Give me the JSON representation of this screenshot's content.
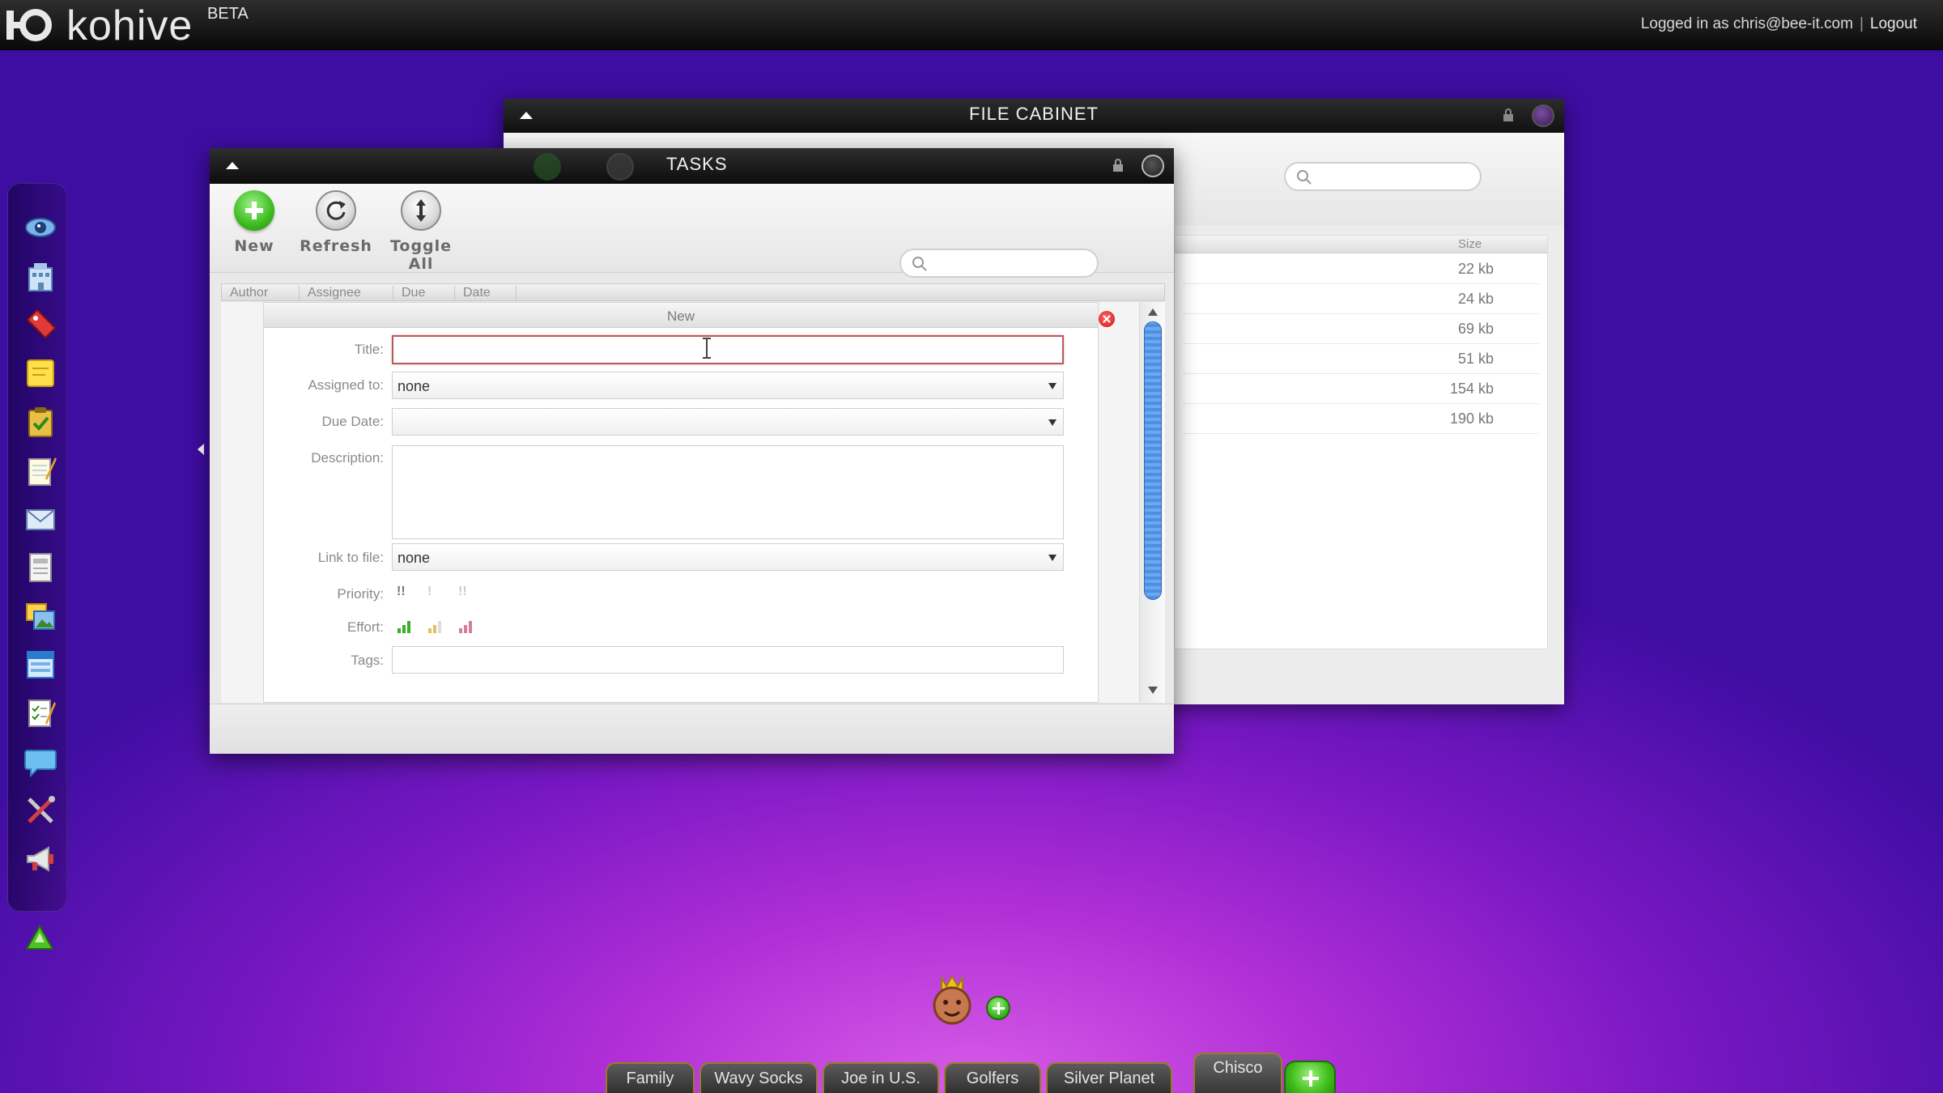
{
  "topbar": {
    "app_name": "kohive",
    "beta": "BETA",
    "logged_in_text": "Logged in as chris@bee-it.com",
    "separator": "|",
    "logout": "Logout"
  },
  "dock": {
    "icons": [
      "eye-icon",
      "building-icon",
      "tag-icon",
      "sticky-note-icon",
      "clipboard-icon",
      "notepad-icon",
      "mail-icon",
      "document-icon",
      "photos-icon",
      "window-icon",
      "checklist-icon",
      "chat-bubble-icon",
      "tools-icon",
      "megaphone-icon",
      "up-triangle-icon"
    ]
  },
  "file_cabinet": {
    "title": "FILE CABINET",
    "size_header": "Size",
    "sizes": [
      "22 kb",
      "24 kb",
      "69 kb",
      "51 kb",
      "154 kb",
      "190 kb"
    ]
  },
  "tasks": {
    "title": "TASKS",
    "toolbar": {
      "new_label": "New",
      "refresh_label": "Refresh",
      "toggle_label": "Toggle All"
    },
    "search": {
      "placeholder": ""
    },
    "columns": [
      "Author",
      "Assignee",
      "Due",
      "Date"
    ],
    "form": {
      "header": "New",
      "title_label": "Title:",
      "title_value": "",
      "assigned_label": "Assigned to:",
      "assigned_value": "none",
      "due_label": "Due Date:",
      "due_value": "",
      "description_label": "Description:",
      "link_label": "Link to file:",
      "link_value": "none",
      "priority_label": "Priority:",
      "priority_options": [
        "!!",
        "!",
        "!!"
      ],
      "effort_label": "Effort:",
      "tags_label": "Tags:"
    }
  },
  "hives": {
    "tabs": [
      "Family",
      "Wavy Socks",
      "Joe in U.S.",
      "Golfers",
      "Silver Planet",
      "Chisco"
    ],
    "active": "Chisco"
  },
  "colors": {
    "accent_green": "#3cbb1e",
    "scroll_blue": "#4d8fe0",
    "background_purple": "#7a18c4"
  }
}
